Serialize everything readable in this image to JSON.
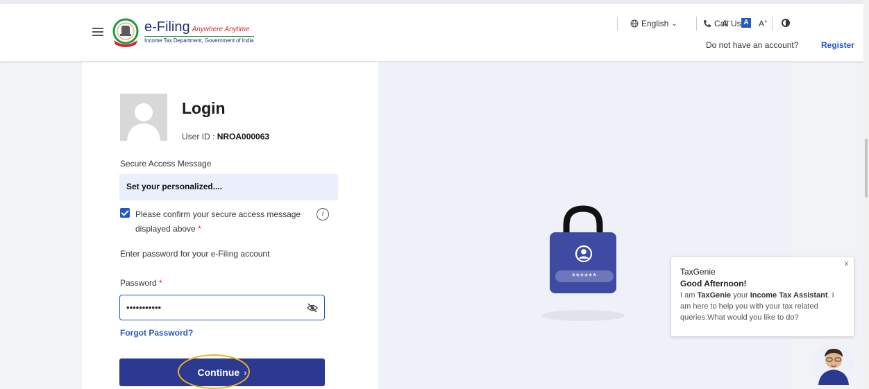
{
  "header": {
    "logo_title": "e-Filing",
    "logo_tagline": "Anywhere Anytime",
    "logo_subtitle": "Income Tax Department, Government of India",
    "call_us": "Call Us",
    "language": "English",
    "font_decrease": "A-",
    "font_normal": "A",
    "font_increase": "A+",
    "account_prompt": "Do not have an account?",
    "register_label": "Register"
  },
  "login": {
    "title": "Login",
    "user_id_label": "User ID :",
    "user_id_value": "NROA000063",
    "secure_access_label": "Secure Access Message",
    "secure_access_message": "Set your personalized....",
    "confirm_checked": true,
    "confirm_text": "Please confirm your secure access message displayed above",
    "required_mark": "*",
    "password_instruction": "Enter password for your e-Filing account",
    "password_label": "Password",
    "password_value": "•••••••••••",
    "forgot_password": "Forgot Password?",
    "continue_label": "Continue",
    "continue_chevron": "›"
  },
  "lock": {
    "password_mask": "******"
  },
  "chat": {
    "close_label": "x",
    "title": "TaxGenie",
    "greeting": "Good Afternoon!",
    "body_prefix": "I am ",
    "assistant_name": "TaxGenie",
    "body_mid": " your ",
    "assistant_role": "Income Tax Assistant",
    "body_suffix": ". I am here to help you with your tax related queries.What would you like to do?"
  },
  "colors": {
    "primary": "#2457c5",
    "button": "#2b3990",
    "lock_body": "#3f4aa3",
    "highlight": "#f0b41c",
    "required": "#d6262b"
  },
  "icons": [
    "hamburger-icon",
    "emblem-logo",
    "phone-icon",
    "globe-icon",
    "chevron-down-icon",
    "contrast-icon",
    "info-icon",
    "eye-slash-icon",
    "lock-icon",
    "user-circle-icon",
    "chat-avatar-icon"
  ]
}
